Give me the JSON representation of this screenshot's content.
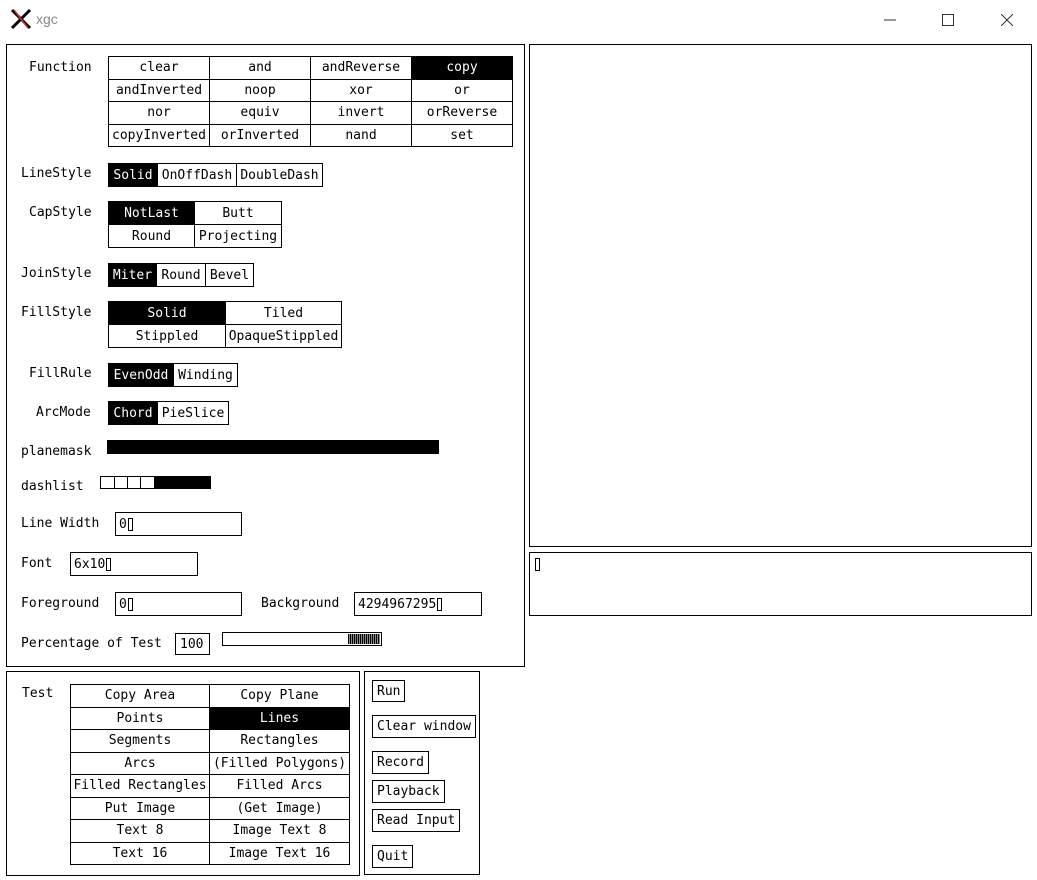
{
  "window": {
    "title": "xgc"
  },
  "gc": {
    "function": {
      "label": "Function",
      "options": [
        "clear",
        "and",
        "andReverse",
        "copy",
        "andInverted",
        "noop",
        "xor",
        "or",
        "nor",
        "equiv",
        "invert",
        "orReverse",
        "copyInverted",
        "orInverted",
        "nand",
        "set"
      ],
      "selected": "copy"
    },
    "linestyle": {
      "label": "LineStyle",
      "options": [
        "Solid",
        "OnOffDash",
        "DoubleDash"
      ],
      "selected": "Solid"
    },
    "capstyle": {
      "label": "CapStyle",
      "options": [
        "NotLast",
        "Butt",
        "Round",
        "Projecting"
      ],
      "selected": "NotLast"
    },
    "joinstyle": {
      "label": "JoinStyle",
      "options": [
        "Miter",
        "Round",
        "Bevel"
      ],
      "selected": "Miter"
    },
    "fillstyle": {
      "label": "FillStyle",
      "options": [
        "Solid",
        "Tiled",
        "Stippled",
        "OpaqueStippled"
      ],
      "selected": "Solid"
    },
    "fillrule": {
      "label": "FillRule",
      "options": [
        "EvenOdd",
        "Winding"
      ],
      "selected": "EvenOdd"
    },
    "arcmode": {
      "label": "ArcMode",
      "options": [
        "Chord",
        "PieSlice"
      ],
      "selected": "Chord"
    },
    "planemask": {
      "label": "planemask"
    },
    "dashlist": {
      "label": "dashlist"
    },
    "linewidth": {
      "label": "Line Width",
      "value": "0"
    },
    "font": {
      "label": "Font",
      "value": "6x10"
    },
    "foreground": {
      "label": "Foreground",
      "value": "0"
    },
    "background": {
      "label": "Background",
      "value": "4294967295"
    },
    "percentage": {
      "label": "Percentage of Test",
      "value": "100",
      "fraction": 1.0
    }
  },
  "test": {
    "label": "Test",
    "options": [
      "Copy Area",
      "Copy Plane",
      "Points",
      "Lines",
      "Segments",
      "Rectangles",
      "Arcs",
      "(Filled Polygons)",
      "Filled Rectangles",
      "Filled Arcs",
      "Put Image",
      "(Get Image)",
      "Text 8",
      "Image Text 8",
      "Text 16",
      "Image Text 16"
    ],
    "selected": "Lines"
  },
  "buttons": {
    "run": "Run",
    "clear_window": "Clear window",
    "record": "Record",
    "playback": "Playback",
    "read_input": "Read Input",
    "quit": "Quit"
  },
  "colors": {
    "selected_bg": "#000000",
    "selected_fg": "#ffffff"
  }
}
